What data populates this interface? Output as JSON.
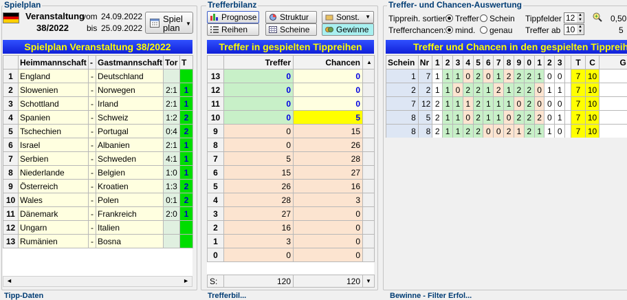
{
  "spielplan": {
    "group_title": "Spielplan",
    "veranstaltung_label": "Veranstaltung",
    "veranstaltung_number": "38/2022",
    "vom_label": "vom",
    "vom_date": "24.09.2022",
    "bis_label": "bis",
    "bis_date": "25.09.2022",
    "spielplan_btn_line1": "Spiel",
    "spielplan_btn_line2": "plan",
    "header_title": "Spielplan Veranstaltung 38/2022",
    "col_heim": "Heimmannschaft",
    "col_sep": "-",
    "col_gast": "Gastmannschaft",
    "col_tor": "Tor",
    "col_t": "T",
    "rows": [
      {
        "n": "1",
        "heim": "England",
        "sep": "-",
        "gast": "Deutschland",
        "tor": "",
        "t": ""
      },
      {
        "n": "2",
        "heim": "Slowenien",
        "sep": "-",
        "gast": "Norwegen",
        "tor": "2:1",
        "t": "1"
      },
      {
        "n": "3",
        "heim": "Schottland",
        "sep": "-",
        "gast": "Irland",
        "tor": "2:1",
        "t": "1"
      },
      {
        "n": "4",
        "heim": "Spanien",
        "sep": "-",
        "gast": "Schweiz",
        "tor": "1:2",
        "t": "2"
      },
      {
        "n": "5",
        "heim": "Tschechien",
        "sep": "-",
        "gast": "Portugal",
        "tor": "0:4",
        "t": "2"
      },
      {
        "n": "6",
        "heim": "Israel",
        "sep": "-",
        "gast": "Albanien",
        "tor": "2:1",
        "t": "1"
      },
      {
        "n": "7",
        "heim": "Serbien",
        "sep": "-",
        "gast": "Schweden",
        "tor": "4:1",
        "t": "1"
      },
      {
        "n": "8",
        "heim": "Niederlande",
        "sep": "-",
        "gast": "Belgien",
        "tor": "1:0",
        "t": "1"
      },
      {
        "n": "9",
        "heim": "Österreich",
        "sep": "-",
        "gast": "Kroatien",
        "tor": "1:3",
        "t": "2"
      },
      {
        "n": "10",
        "heim": "Wales",
        "sep": "-",
        "gast": "Polen",
        "tor": "0:1",
        "t": "2"
      },
      {
        "n": "11",
        "heim": "Dänemark",
        "sep": "-",
        "gast": "Frankreich",
        "tor": "2:0",
        "t": "1"
      },
      {
        "n": "12",
        "heim": "Ungarn",
        "sep": "-",
        "gast": "Italien",
        "tor": "",
        "t": ""
      },
      {
        "n": "13",
        "heim": "Rumänien",
        "sep": "-",
        "gast": "Bosna",
        "tor": "",
        "t": ""
      }
    ],
    "bottom_label": "Tipp-Daten"
  },
  "trefferbilanz": {
    "group_title": "Trefferbilanz",
    "btn_prognose": "Prognose",
    "btn_struktur": "Struktur",
    "btn_sonst": "Sonst.",
    "btn_reihen": "Reihen",
    "btn_scheine": "Scheine",
    "btn_gewinne": "Gewinne",
    "header_title": "Treffer in gespielten Tippreihen",
    "col_treffer": "Treffer",
    "col_chancen": "Chancen",
    "rows": [
      {
        "n": "13",
        "treffer": "0",
        "chancen": "0"
      },
      {
        "n": "12",
        "treffer": "0",
        "chancen": "0"
      },
      {
        "n": "11",
        "treffer": "0",
        "chancen": "0"
      },
      {
        "n": "10",
        "treffer": "0",
        "chancen": "5"
      },
      {
        "n": "9",
        "treffer": "0",
        "chancen": "15"
      },
      {
        "n": "8",
        "treffer": "0",
        "chancen": "26"
      },
      {
        "n": "7",
        "treffer": "5",
        "chancen": "28"
      },
      {
        "n": "6",
        "treffer": "15",
        "chancen": "27"
      },
      {
        "n": "5",
        "treffer": "26",
        "chancen": "16"
      },
      {
        "n": "4",
        "treffer": "28",
        "chancen": "3"
      },
      {
        "n": "3",
        "treffer": "27",
        "chancen": "0"
      },
      {
        "n": "2",
        "treffer": "16",
        "chancen": "0"
      },
      {
        "n": "1",
        "treffer": "3",
        "chancen": "0"
      },
      {
        "n": "0",
        "treffer": "0",
        "chancen": "0"
      }
    ],
    "sum_label": "S:",
    "sum_treffer": "120",
    "sum_chancen": "120",
    "bottom_label": "Trefferbil..."
  },
  "auswertung": {
    "group_title": "Treffer- und Chancen-Auswertung",
    "sort_label": "Tippreih. sortiert:",
    "sort_opt1": "Treffer",
    "sort_opt2": "Schein",
    "chancen_label": "Trefferchancen:",
    "chancen_opt1": "mind.",
    "chancen_opt2": "genau",
    "tippfelder_label": "Tippfelder",
    "tippfelder_value": "12",
    "treffer_ab_label": "Treffer ab",
    "treffer_ab_value": "10",
    "right_value1": "0,50",
    "right_value2": "5",
    "header_title": "Treffer und Chancen in den gespielten Tippreihen",
    "col_schein": "Schein",
    "col_nr": "Nr",
    "col_digits": [
      "1",
      "2",
      "3",
      "4",
      "5",
      "6",
      "7",
      "8",
      "9",
      "0",
      "1",
      "2",
      "3"
    ],
    "col_t": "T",
    "col_c": "C",
    "col_g": "G",
    "rows": [
      {
        "schein": "1",
        "nr": "7",
        "tips": [
          "1",
          "1",
          "1",
          "0",
          "2",
          "0",
          "1",
          "2",
          "2",
          "2",
          "1",
          "0",
          "0"
        ],
        "t": "7",
        "c": "10"
      },
      {
        "schein": "2",
        "nr": "2",
        "tips": [
          "1",
          "1",
          "0",
          "2",
          "2",
          "1",
          "2",
          "1",
          "2",
          "2",
          "0",
          "1",
          "1"
        ],
        "t": "7",
        "c": "10"
      },
      {
        "schein": "7",
        "nr": "12",
        "tips": [
          "2",
          "1",
          "1",
          "1",
          "2",
          "1",
          "1",
          "1",
          "0",
          "2",
          "0",
          "0",
          "0"
        ],
        "t": "7",
        "c": "10"
      },
      {
        "schein": "8",
        "nr": "5",
        "tips": [
          "2",
          "1",
          "1",
          "0",
          "2",
          "1",
          "1",
          "0",
          "2",
          "2",
          "2",
          "0",
          "1"
        ],
        "t": "7",
        "c": "10"
      },
      {
        "schein": "8",
        "nr": "8",
        "tips": [
          "2",
          "1",
          "1",
          "2",
          "2",
          "0",
          "0",
          "2",
          "1",
          "2",
          "1",
          "1",
          "0"
        ],
        "t": "7",
        "c": "10"
      }
    ],
    "bottom_label": "Bewinne - Filter Erfol..."
  },
  "colors": {
    "accent_blue": "#1a2ee8",
    "title_yellow": "#ffff00",
    "green_cell": "#00dd00",
    "pale_yellow": "#ffffe0",
    "peach": "#fce4d0",
    "light_green": "#c8f0c8",
    "highlight_yellow": "#ffff00",
    "row_blue": "#dde6f4"
  }
}
